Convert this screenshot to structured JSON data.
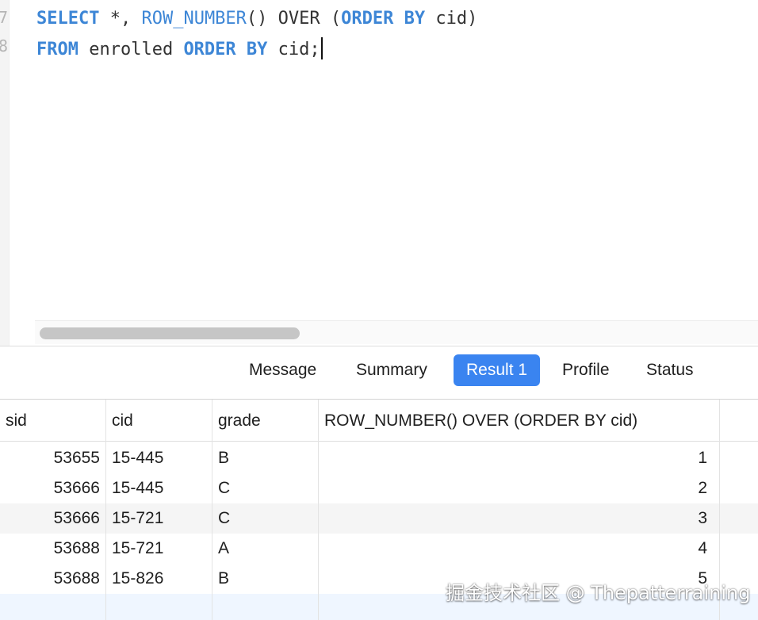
{
  "editor": {
    "line_numbers": [
      "7",
      "8"
    ],
    "line1": {
      "kw_select": "SELECT",
      "star": " *, ",
      "fn_row_number": "ROW_NUMBER",
      "mid": "() OVER (",
      "kw_order": "ORDER",
      "sp": " ",
      "kw_by": "BY",
      "end": " cid)"
    },
    "line2": {
      "kw_from": "FROM",
      "table": " enrolled ",
      "kw_order": "ORDER",
      "sp": " ",
      "kw_by": "BY",
      "end": " cid;"
    }
  },
  "tabs": [
    {
      "label": "Message",
      "active": false
    },
    {
      "label": "Summary",
      "active": false
    },
    {
      "label": "Result 1",
      "active": true
    },
    {
      "label": "Profile",
      "active": false
    },
    {
      "label": "Status",
      "active": false
    }
  ],
  "result": {
    "columns": [
      "sid",
      "cid",
      "grade",
      "ROW_NUMBER() OVER (ORDER BY cid)"
    ],
    "rows": [
      [
        "53655",
        "15-445",
        "B",
        "1"
      ],
      [
        "53666",
        "15-445",
        "C",
        "2"
      ],
      [
        "53666",
        "15-721",
        "C",
        "3"
      ],
      [
        "53688",
        "15-721",
        "A",
        "4"
      ],
      [
        "53688",
        "15-826",
        "B",
        "5"
      ]
    ]
  },
  "watermark": "掘金技术社区 @ Thepatterraining",
  "colors": {
    "keyword": "#3d86d6",
    "active_tab": "#3a84f0",
    "row_stripe": "#f5f5f5"
  }
}
